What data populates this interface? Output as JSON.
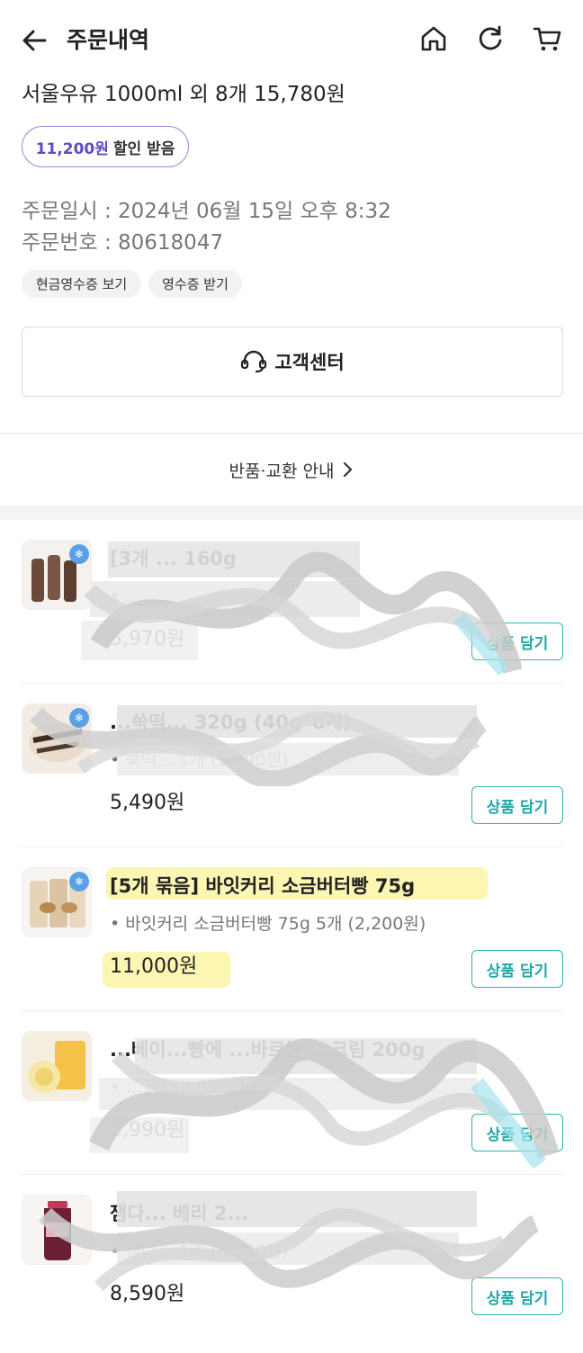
{
  "header": {
    "title": "주문내역",
    "icons": {
      "back": "arrow-left-icon",
      "home": "home-icon",
      "refresh": "refresh-icon",
      "cart": "cart-icon"
    }
  },
  "summary": {
    "title": "서울우유 1000ml 외 8개 15,780원",
    "discount_amount": "11,200원",
    "discount_text": "할인 받음"
  },
  "order": {
    "date_label": "주문일시 : ",
    "date_value": "2024년 06월 15일 오후 8:32",
    "number_label": "주문번호 : ",
    "number_value": "80618047"
  },
  "pills": {
    "cash_receipt": "현금영수증 보기",
    "receipt": "영수증 받기"
  },
  "customer_center": {
    "label": "고객센터",
    "icon": "headset-icon"
  },
  "return_exchange": {
    "label": "반품·교환 안내",
    "icon": "chevron-right-icon"
  },
  "colors": {
    "accent_purple": "#5f4bc4",
    "accent_teal": "#20a8a8",
    "highlight": "#fbf39a"
  },
  "items": [
    {
      "name": "[3개 ... 160g",
      "detail": "• ...",
      "price": "5,970원",
      "button": "상품 담기"
    },
    {
      "name": "...쑥떡... 320g (40g*8개)",
      "detail": "• 쑥떡... 1개 (5,490원)",
      "price": "5,490원",
      "button": "상품 담기"
    },
    {
      "name": "[5개 묶음] 바잇커리 소금버터빵 75g",
      "detail": "• 바잇커리 소금버터빵 75g 5개 (2,200원)",
      "price": "11,000원",
      "button": "상품 담기"
    },
    {
      "name": "...베이...빵에 ...바르는 ...크림 200g",
      "detail": "• ...1개 (2,990원)",
      "price": "2,990원",
      "button": "상품 담기"
    },
    {
      "name": "잼다... 베리 2...",
      "detail": "• 잼다... 1개 (8,590원)",
      "price": "8,590원",
      "button": "상품 담기"
    }
  ]
}
